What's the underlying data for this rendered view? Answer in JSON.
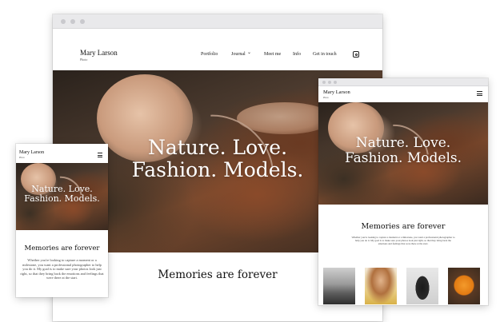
{
  "brand": {
    "name": "Mary Larson",
    "subtitle": "Photo"
  },
  "nav": {
    "items": [
      "Portfolio",
      "Journal",
      "Meet me",
      "Info",
      "Get in touch"
    ],
    "journal_caret": "⌄",
    "social_icon": "instagram-icon"
  },
  "hero": {
    "line1": "Nature. Love.",
    "line2": "Fashion. Models."
  },
  "section": {
    "heading": "Memories are forever",
    "body": "Whether you're looking to capture a moment or a milestone, you want a professional photographer to help you do it. My goal is to make sure your photos look just right, so that they bring back the emotions and feelings that were there at the start."
  },
  "gallery": {
    "thumbs": [
      "landscape-bw",
      "woman-yellow",
      "silhouette-bw",
      "orange-fruit"
    ]
  },
  "colors": {
    "chrome": "#e9e9eb",
    "dot": "#c9c9cd",
    "hero_dark": "#2a221c",
    "hero_rust": "#8a4a2a"
  }
}
